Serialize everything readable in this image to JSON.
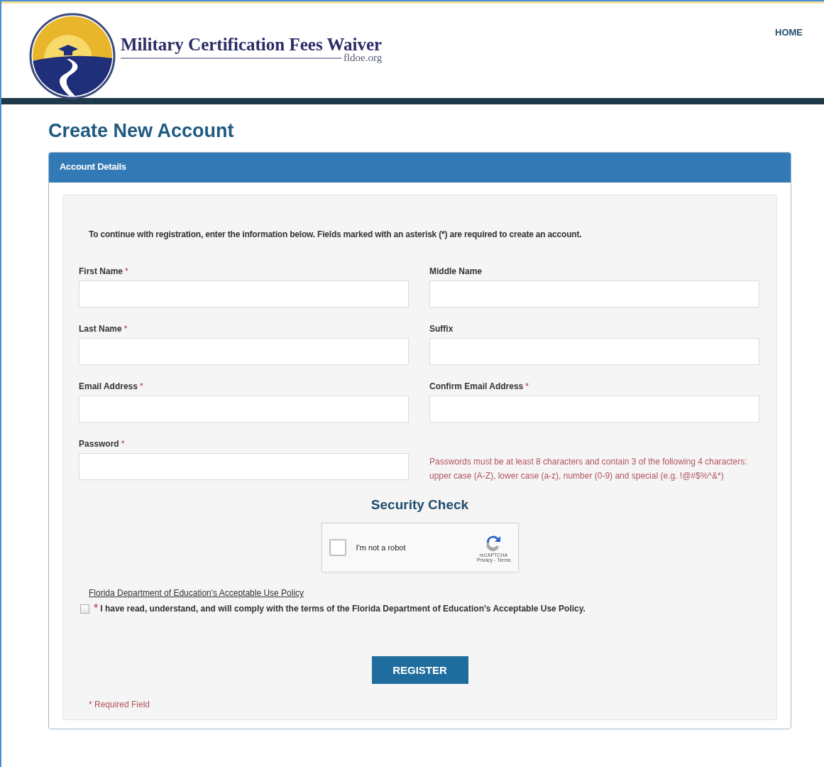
{
  "header": {
    "site_title": "Military Certification Fees Waiver",
    "site_subtitle": "fldoe.org",
    "nav": [
      {
        "label": "HOME"
      }
    ]
  },
  "page_title": "Create New Account",
  "panel": {
    "title": "Account Details",
    "intro": "To continue with registration, enter the information below. Fields marked with an asterisk (*) are required to create an account.",
    "fields": [
      {
        "label": "First Name",
        "required_mark": "*"
      },
      {
        "label": "Middle Name"
      },
      {
        "label": "Last Name",
        "required_mark": "*"
      },
      {
        "label": "Suffix"
      },
      {
        "label": "Email Address",
        "required_mark": "*"
      },
      {
        "label": "Confirm Email Address",
        "required_mark": "*"
      },
      {
        "label": "Password",
        "required_mark": "*"
      }
    ],
    "password_hint": "Passwords must be at least 8 characters and contain 3 of the following 4 characters: upper case (A-Z), lower case (a-z), number (0-9) and special (e.g. !@#$%^&*)",
    "security_title": "Security Check",
    "captcha": {
      "label": "I'm not a robot",
      "checked": false,
      "brand": "reCAPTCHA",
      "links": "Privacy - Terms"
    },
    "policy_link": "Florida Department of Education's Acceptable Use Policy",
    "agreement": {
      "required_mark": "*",
      "text": "I have read, understand, and will comply with the terms of the Florida Department of Education's Acceptable Use Policy.",
      "checked": false
    },
    "submit": "REGISTER",
    "required_note": "* Required Field"
  }
}
